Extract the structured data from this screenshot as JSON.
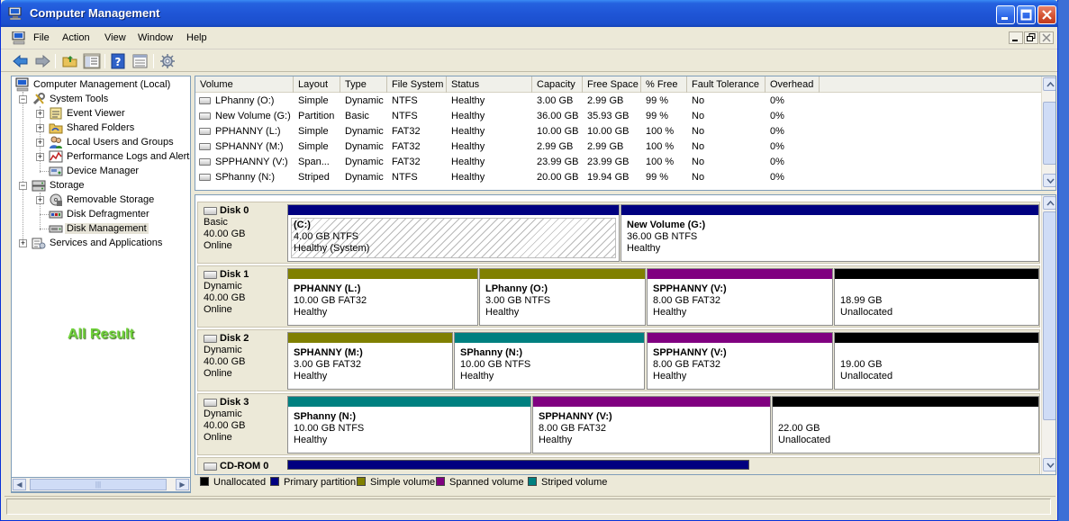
{
  "window": {
    "title": "Computer Management"
  },
  "menu": {
    "items": [
      "File",
      "Action",
      "View",
      "Window",
      "Help"
    ]
  },
  "tree": {
    "root": "Computer Management (Local)",
    "system_tools": "System Tools",
    "event_viewer": "Event Viewer",
    "shared_folders": "Shared Folders",
    "local_users": "Local Users and Groups",
    "perf_logs": "Performance Logs and Alerts",
    "device_manager": "Device Manager",
    "storage": "Storage",
    "removable_storage": "Removable Storage",
    "disk_defrag": "Disk Defragmenter",
    "disk_management": "Disk Management",
    "services_apps": "Services and Applications",
    "annotation": "All Result"
  },
  "volume_list": {
    "columns": [
      "Volume",
      "Layout",
      "Type",
      "File System",
      "Status",
      "Capacity",
      "Free Space",
      "% Free",
      "Fault Tolerance",
      "Overhead"
    ],
    "rows": [
      [
        "LPhanny (O:)",
        "Simple",
        "Dynamic",
        "NTFS",
        "Healthy",
        "3.00 GB",
        "2.99 GB",
        "99 %",
        "No",
        "0%"
      ],
      [
        "New Volume (G:)",
        "Partition",
        "Basic",
        "NTFS",
        "Healthy",
        "36.00 GB",
        "35.93 GB",
        "99 %",
        "No",
        "0%"
      ],
      [
        "PPHANNY (L:)",
        "Simple",
        "Dynamic",
        "FAT32",
        "Healthy",
        "10.00 GB",
        "10.00 GB",
        "100 %",
        "No",
        "0%"
      ],
      [
        "SPHANNY (M:)",
        "Simple",
        "Dynamic",
        "FAT32",
        "Healthy",
        "2.99 GB",
        "2.99 GB",
        "100 %",
        "No",
        "0%"
      ],
      [
        "SPPHANNY (V:)",
        "Span...",
        "Dynamic",
        "FAT32",
        "Healthy",
        "23.99 GB",
        "23.99 GB",
        "100 %",
        "No",
        "0%"
      ],
      [
        "SPhanny (N:)",
        "Striped",
        "Dynamic",
        "NTFS",
        "Healthy",
        "20.00 GB",
        "19.94 GB",
        "99 %",
        "No",
        "0%"
      ]
    ]
  },
  "disks": [
    {
      "name": "Disk 0",
      "kind": "Basic",
      "size": "40.00 GB",
      "state": "Online",
      "partitions": [
        {
          "title": "(C:)",
          "size": "4.00 GB NTFS",
          "status": "Healthy (System)",
          "color": "#000080",
          "hatched": true
        },
        {
          "title": "New Volume  (G:)",
          "size": "36.00 GB NTFS",
          "status": "Healthy",
          "color": "#000080",
          "hatched": false
        }
      ]
    },
    {
      "name": "Disk 1",
      "kind": "Dynamic",
      "size": "40.00 GB",
      "state": "Online",
      "partitions": [
        {
          "title": "PPHANNY  (L:)",
          "size": "10.00 GB FAT32",
          "status": "Healthy",
          "color": "#808000"
        },
        {
          "title": "LPhanny  (O:)",
          "size": "3.00 GB NTFS",
          "status": "Healthy",
          "color": "#808000"
        },
        {
          "title": "SPPHANNY  (V:)",
          "size": "8.00 GB FAT32",
          "status": "Healthy",
          "color": "#800080"
        },
        {
          "title": "",
          "size": "18.99 GB",
          "status": "Unallocated",
          "color": "#000000"
        }
      ]
    },
    {
      "name": "Disk 2",
      "kind": "Dynamic",
      "size": "40.00 GB",
      "state": "Online",
      "partitions": [
        {
          "title": "SPHANNY  (M:)",
          "size": "3.00 GB FAT32",
          "status": "Healthy",
          "color": "#808000"
        },
        {
          "title": "SPhanny  (N:)",
          "size": "10.00 GB NTFS",
          "status": "Healthy",
          "color": "#008080"
        },
        {
          "title": "SPPHANNY  (V:)",
          "size": "8.00 GB FAT32",
          "status": "Healthy",
          "color": "#800080"
        },
        {
          "title": "",
          "size": "19.00 GB",
          "status": "Unallocated",
          "color": "#000000"
        }
      ]
    },
    {
      "name": "Disk 3",
      "kind": "Dynamic",
      "size": "40.00 GB",
      "state": "Online",
      "partitions": [
        {
          "title": "SPhanny  (N:)",
          "size": "10.00 GB NTFS",
          "status": "Healthy",
          "color": "#008080"
        },
        {
          "title": "SPPHANNY  (V:)",
          "size": "8.00 GB FAT32",
          "status": "Healthy",
          "color": "#800080"
        },
        {
          "title": "",
          "size": "22.00 GB",
          "status": "Unallocated",
          "color": "#000000"
        }
      ]
    }
  ],
  "cdrom": {
    "name": "CD-ROM 0",
    "color": "#000080"
  },
  "legend": [
    {
      "label": "Unallocated",
      "color": "#000000"
    },
    {
      "label": "Primary partition",
      "color": "#000080"
    },
    {
      "label": "Simple volume",
      "color": "#808000"
    },
    {
      "label": "Spanned volume",
      "color": "#800080"
    },
    {
      "label": "Striped volume",
      "color": "#008080"
    }
  ],
  "icons": [
    "computer-icon",
    "back-arrow-icon",
    "forward-arrow-icon",
    "up-folder-icon",
    "show-hide-tree-icon",
    "help-icon",
    "export-list-icon",
    "properties-icon"
  ]
}
